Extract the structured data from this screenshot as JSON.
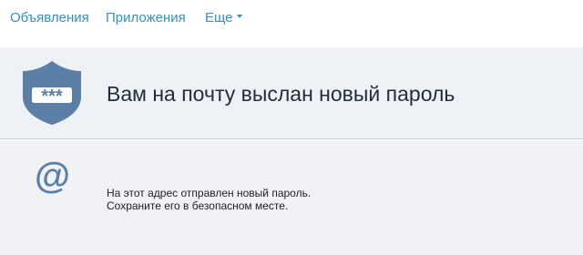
{
  "nav": {
    "items": [
      {
        "label": "Объявления"
      },
      {
        "label": "Приложения"
      },
      {
        "label": "Еще"
      }
    ]
  },
  "banner": {
    "title": "Вам на почту выслан новый пароль",
    "icon": "shield-password-icon",
    "password_mask": "***"
  },
  "content": {
    "icon": "at-icon",
    "at_symbol": "@",
    "line1": "На этот адрес отправлен новый пароль.",
    "line2": "Сохраните его в безопасном месте."
  },
  "colors": {
    "link": "#3391c8",
    "shield": "#5b7fa6",
    "banner_bg": "#eef1f5",
    "content_bg": "#f0f2f6",
    "title_text": "#1f2d3d"
  }
}
